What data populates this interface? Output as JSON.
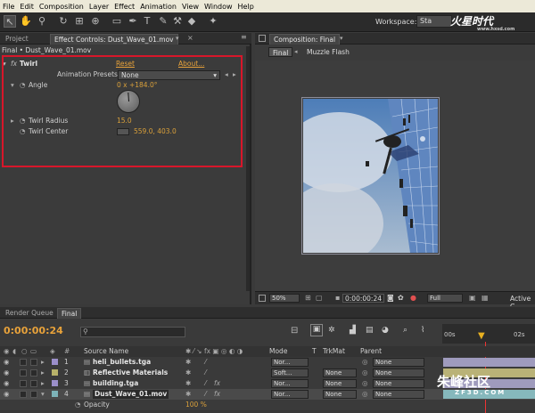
{
  "menu": [
    "File",
    "Edit",
    "Composition",
    "Layer",
    "Effect",
    "Animation",
    "View",
    "Window",
    "Help"
  ],
  "workspace": {
    "label": "Workspace:",
    "value": "Sta"
  },
  "logo": {
    "main": "火星时代",
    "sub": "www.hxsd.com"
  },
  "left_tabs": {
    "project": "Project",
    "effect_controls": "Effect Controls: Dust_Wave_01.mov"
  },
  "breadcrumb": "Final • Dust_Wave_01.mov",
  "effect": {
    "name": "Twirl",
    "fx": "fx",
    "reset": "Reset",
    "about": "About...",
    "presets_label": "Animation Presets:",
    "presets_value": "None",
    "angle_label": "Angle",
    "angle_value": "0 x +184.0°",
    "radius_label": "Twirl Radius",
    "radius_value": "15.0",
    "center_label": "Twirl Center",
    "center_value": "559.0, 403.0"
  },
  "comp": {
    "tab": "Composition: Final",
    "crumb1": "Final",
    "crumb2": "Muzzle Flash",
    "zoom": "50%",
    "timecode": "0:00:00:24",
    "resolution": "Full",
    "active": "Active C"
  },
  "timeline": {
    "tabs": [
      "Render Queue",
      "Final"
    ],
    "timecode": "0:00:00:24",
    "search_placeholder": "",
    "headers": {
      "source": "Source Name",
      "mode": "Mode",
      "t": "T",
      "trkmat": "TrkMat",
      "parent": "Parent"
    },
    "ruler": [
      "00s",
      "02s"
    ],
    "layers": [
      {
        "num": "1",
        "name": "heli_bullets.tga",
        "mode": "Nor...",
        "trkmat": "",
        "parent": "None",
        "color": "#9b8fc9"
      },
      {
        "num": "2",
        "name": "Reflective Materials",
        "mode": "Soft...",
        "trkmat": "None",
        "parent": "None",
        "color": "#b8b26a"
      },
      {
        "num": "3",
        "name": "building.tga",
        "mode": "Nor...",
        "trkmat": "None",
        "parent": "None",
        "color": "#9b8fc9"
      },
      {
        "num": "4",
        "name": "Dust_Wave_01.mov",
        "mode": "Nor...",
        "trkmat": "None",
        "parent": "None",
        "color": "#7db3b8"
      }
    ],
    "opacity_label": "Opacity",
    "opacity_value": "100 %"
  },
  "watermark": {
    "main": "朱峰社区",
    "sub": "ZF3D.COM"
  }
}
